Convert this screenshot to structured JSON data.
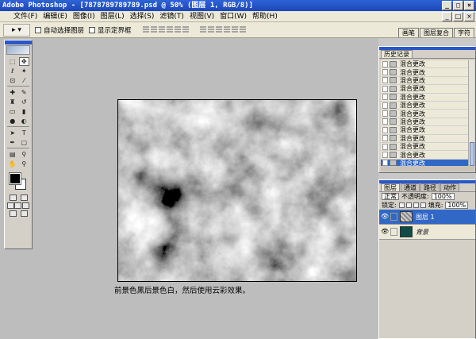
{
  "window": {
    "title": "Adobe Photoshop - [7878789789789.psd @ 50% (图层 1, RGB/8)]",
    "controls": [
      "_",
      "□",
      "×"
    ]
  },
  "menubar": {
    "items": [
      "文件(F)",
      "编辑(E)",
      "图像(I)",
      "图层(L)",
      "选择(S)",
      "滤镜(T)",
      "视图(V)",
      "窗口(W)",
      "帮助(H)"
    ]
  },
  "options": {
    "auto_select_label": "自动选择图层",
    "show_bounds_label": "显示定界框",
    "tool_preset": "▸ ▾"
  },
  "palette_well": {
    "tabs": [
      "画笔",
      "图层复合",
      "字符"
    ]
  },
  "history": {
    "tab": "历史记录",
    "items": [
      "混合更改",
      "混合更改",
      "混合更改",
      "混合更改",
      "混合更改",
      "混合更改",
      "混合更改",
      "混合更改",
      "混合更改",
      "混合更改",
      "混合更改",
      "混合更改",
      "混合更改"
    ],
    "active_index": 12
  },
  "layers": {
    "tabs": [
      "图层",
      "通道",
      "路径",
      "动作"
    ],
    "blend_mode": "正常",
    "opacity_label": "不透明度:",
    "opacity": "100%",
    "lock_label": "锁定:",
    "fill_label": "填充:",
    "fill": "100%",
    "items": [
      {
        "name": "图层 1",
        "active": true
      },
      {
        "name": "背景",
        "active": false
      }
    ]
  },
  "document": {
    "caption": "前景色黑后景色白，然后使用云彩效果。"
  },
  "colors": {
    "title_bar": "#2e63d6",
    "foreground": "#000000",
    "background": "#ffffff",
    "selection": "#3168c6"
  }
}
